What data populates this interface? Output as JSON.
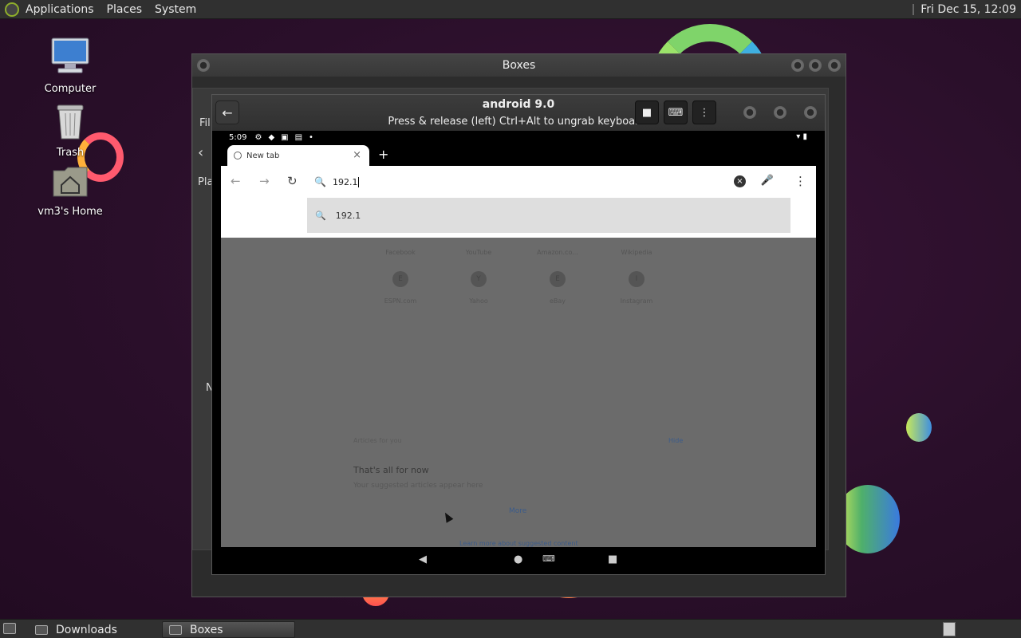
{
  "top_panel": {
    "menus": [
      "Applications",
      "Places",
      "System"
    ],
    "clock": "Fri Dec 15, 12:09"
  },
  "desktop": {
    "icons": [
      {
        "label": "Computer",
        "icon": "computer-icon"
      },
      {
        "label": "Trash",
        "icon": "trash-icon"
      },
      {
        "label": "vm3's Home",
        "icon": "home-folder-icon"
      }
    ]
  },
  "boxes_window": {
    "title": "Boxes",
    "peek": {
      "menu_fragment": "Fil",
      "places_fragment": "Pla",
      "n_fragment": "N"
    }
  },
  "vm": {
    "title": "android 9.0",
    "subtitle": "Press & release (left) Ctrl+Alt to ungrab keyboard.",
    "header_buttons": [
      "stop-icon",
      "keyboard-icon",
      "menu-icon"
    ]
  },
  "android": {
    "status_time": "5:09",
    "tab": {
      "title": "New tab"
    },
    "omnibox": {
      "value": "192.1"
    },
    "suggestion": "192.1",
    "tiles_row1": [
      "Facebook",
      "YouTube",
      "Amazon.co...",
      "Wikipedia"
    ],
    "tiles_row2": [
      "ESPN.com",
      "Yahoo",
      "eBay",
      "Instagram"
    ],
    "tile_initials": [
      "E",
      "Y",
      "E",
      "I"
    ],
    "articles_label": "Articles for you",
    "hide_label": "Hide",
    "all_for_now": "That's all for now",
    "suggested_text": "Your suggested articles appear here",
    "more_label": "More",
    "learn_more": "Learn more about suggested content"
  },
  "taskbar": {
    "items": [
      {
        "label": "Downloads",
        "active": false
      },
      {
        "label": "Boxes",
        "active": true
      }
    ]
  },
  "colors": {
    "desktop_bg": "#2a0f2a",
    "panel_bg": "#303030",
    "android_scrim": "#6b6b6b"
  }
}
